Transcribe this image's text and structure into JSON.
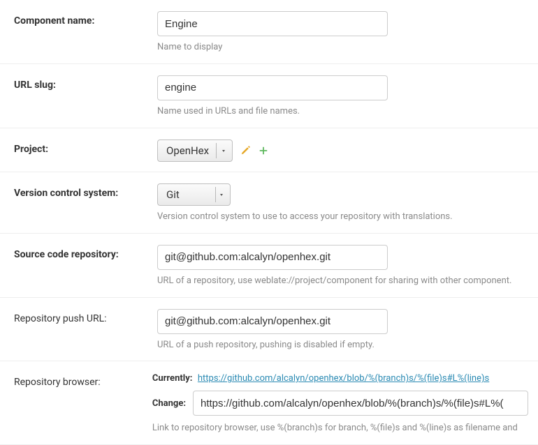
{
  "rows": {
    "component_name": {
      "label": "Component name:",
      "value": "Engine",
      "help": "Name to display"
    },
    "url_slug": {
      "label": "URL slug:",
      "value": "engine",
      "help": "Name used in URLs and file names."
    },
    "project": {
      "label": "Project:",
      "value": "OpenHex"
    },
    "vcs": {
      "label": "Version control system:",
      "value": "Git",
      "help": "Version control system to use to access your repository with translations."
    },
    "source_repo": {
      "label": "Source code repository:",
      "value": "git@github.com:alcalyn/openhex.git",
      "help": "URL of a repository, use weblate://project/component for sharing with other component."
    },
    "push_url": {
      "label": "Repository push URL:",
      "value": "git@github.com:alcalyn/openhex.git",
      "help": "URL of a push repository, pushing is disabled if empty."
    },
    "repo_browser": {
      "label": "Repository browser:",
      "currently_label": "Currently:",
      "currently_value": "https://github.com/alcalyn/openhex/blob/%(branch)s/%(file)s#L%(line)s",
      "change_label": "Change:",
      "change_value": "https://github.com/alcalyn/openhex/blob/%(branch)s/%(file)s#L%(",
      "help": "Link to repository browser, use %(branch)s for branch, %(file)s and %(line)s as filename and"
    }
  }
}
